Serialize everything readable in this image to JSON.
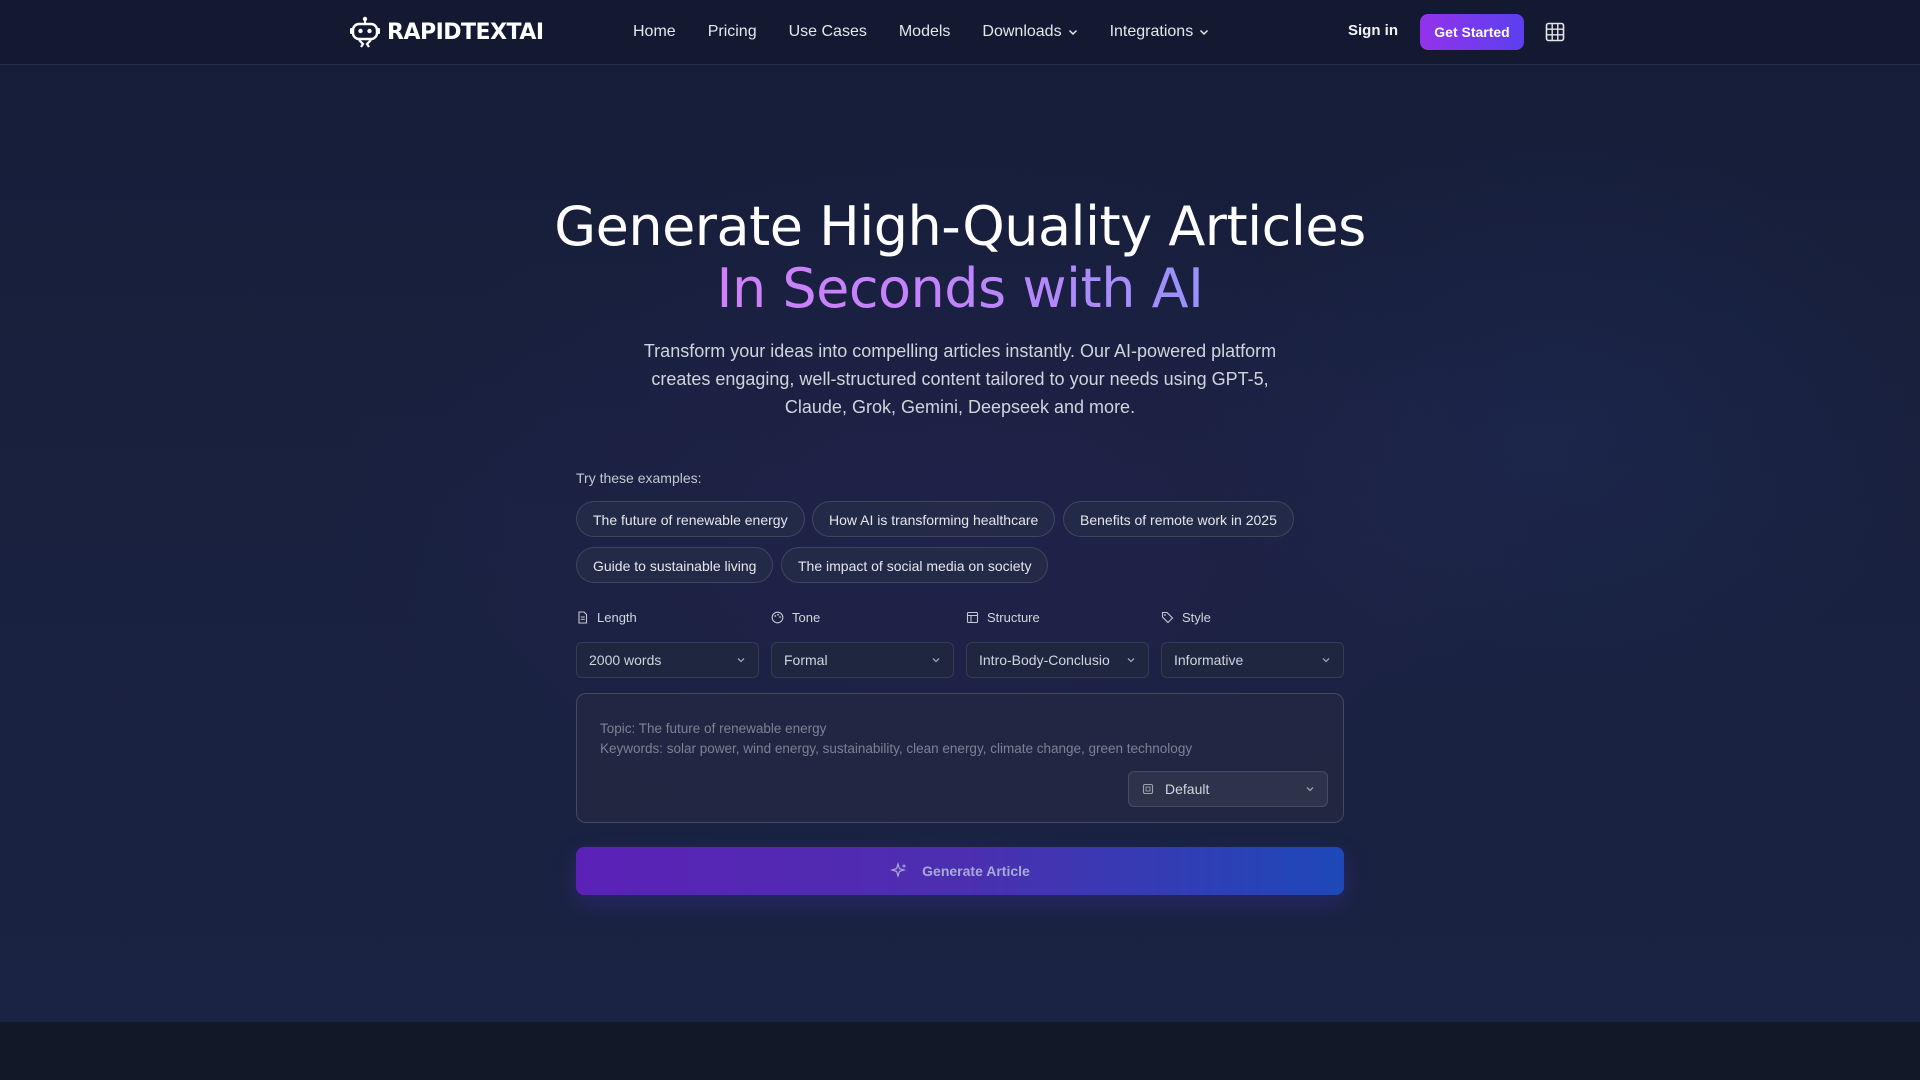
{
  "brand": {
    "name": "RAPIDTEXTAI",
    "logo_icon": "robot-icon"
  },
  "nav": {
    "items": [
      {
        "label": "Home",
        "has_dropdown": false
      },
      {
        "label": "Pricing",
        "has_dropdown": false
      },
      {
        "label": "Use Cases",
        "has_dropdown": false
      },
      {
        "label": "Models",
        "has_dropdown": false
      },
      {
        "label": "Downloads",
        "has_dropdown": true
      },
      {
        "label": "Integrations",
        "has_dropdown": true
      }
    ],
    "sign_in": "Sign in",
    "get_started": "Get Started",
    "apps_icon": "grid-icon"
  },
  "hero": {
    "title_line1": "Generate High-Quality Articles",
    "title_line2": "In Seconds with AI",
    "subtitle": "Transform your ideas into compelling articles instantly. Our AI-powered platform creates engaging, well-structured content tailored to your needs using GPT-5, Claude, Grok, Gemini, Deepseek and more."
  },
  "examples": {
    "label": "Try these examples:",
    "items": [
      "The future of renewable energy",
      "How AI is transforming healthcare",
      "Benefits of remote work in 2025",
      "Guide to sustainable living",
      "The impact of social media on society"
    ]
  },
  "options": [
    {
      "label": "Length",
      "icon": "document-icon",
      "value": "2000 words"
    },
    {
      "label": "Tone",
      "icon": "palette-icon",
      "value": "Formal"
    },
    {
      "label": "Structure",
      "icon": "layout-icon",
      "value": "Intro-Body-Conclusio"
    },
    {
      "label": "Style",
      "icon": "tag-icon",
      "value": "Informative"
    }
  ],
  "prompt": {
    "placeholder": "Topic: The future of renewable energy\nKeywords: solar power, wind energy, sustainability, clean energy, climate change, green technology",
    "model": "Default",
    "model_icon": "chip-icon"
  },
  "generate": {
    "label": "Generate Article",
    "icon": "sparkles-icon"
  },
  "colors": {
    "accent_purple": "#9333ea",
    "accent_blue": "#5b3ff0",
    "gradient_pink": "#e879f9",
    "gradient_blue": "#60a5fa",
    "background": "#19213f"
  }
}
